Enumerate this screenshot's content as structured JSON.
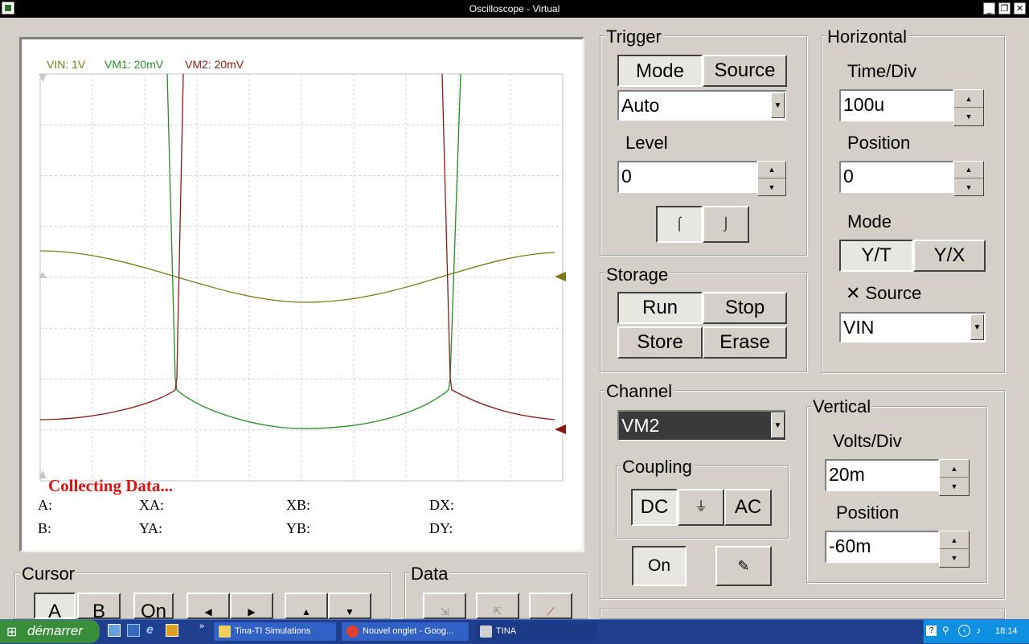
{
  "window": {
    "title": "Oscilloscope - Virtual"
  },
  "screen": {
    "labels": {
      "vin": "VIN: 1V",
      "vm1": "VM1: 20mV",
      "vm2": "VM2: 20mV"
    },
    "status": "Collecting Data...",
    "colors": {
      "vin": "#7a7a1a",
      "vm1": "#2a8a2a",
      "vm2": "#8a1a1a",
      "status": "#e01010"
    },
    "measurements": {
      "a": "A:",
      "b": "B:",
      "xa": "XA:",
      "ya": "YA:",
      "xb": "XB:",
      "yb": "YB:",
      "dx": "DX:",
      "dy": "DY:"
    }
  },
  "trigger": {
    "title": "Trigger",
    "mode_label": "Mode",
    "source_label": "Source",
    "mode_value": "Auto",
    "level_label": "Level",
    "level_value": "0",
    "rising_symbol": "⌠",
    "falling_symbol": "⌡"
  },
  "horizontal": {
    "title": "Horizontal",
    "timediv_label": "Time/Div",
    "timediv_value": "100u",
    "position_label": "Position",
    "position_value": "0",
    "mode_label": "Mode",
    "yt_label": "Y/T",
    "yx_label": "Y/X",
    "xsource_label": "✕ Source",
    "xsource_value": "VIN"
  },
  "storage": {
    "title": "Storage",
    "run": "Run",
    "stop": "Stop",
    "store": "Store",
    "erase": "Erase"
  },
  "channel": {
    "title": "Channel",
    "value": "VM2",
    "coupling_title": "Coupling",
    "dc": "DC",
    "gnd": "⏚",
    "ac": "AC",
    "on": "On"
  },
  "vertical": {
    "title": "Vertical",
    "voltsdiv_label": "Volts/Div",
    "voltsdiv_value": "20m",
    "position_label": "Position",
    "position_value": "-60m"
  },
  "cursor": {
    "title": "Cursor",
    "a": "A",
    "b": "B",
    "on": "On"
  },
  "data": {
    "title": "Data"
  },
  "taskbar": {
    "start": "démarrer",
    "tasks": [
      "Tina-TI Simulations",
      "Nouvel onglet - Goog...",
      "TINA"
    ],
    "clock": "18:14"
  }
}
